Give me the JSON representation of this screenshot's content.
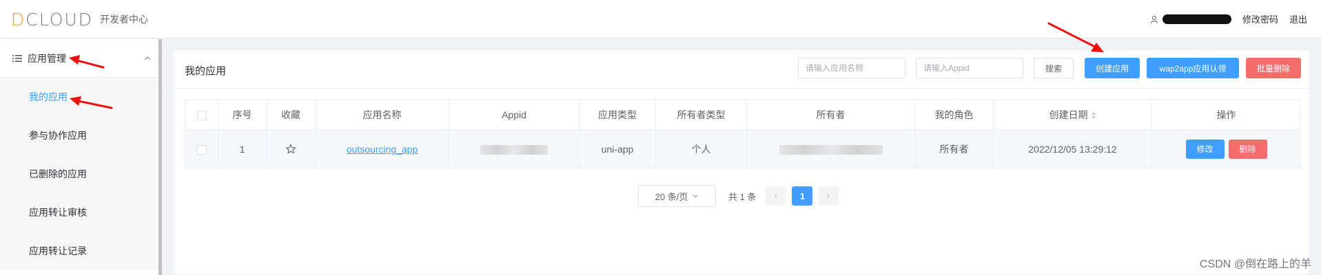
{
  "header": {
    "logo_text_d": "D",
    "logo_text_rest": "CLOUD",
    "logo_subtitle": "开发者中心",
    "change_password": "修改密码",
    "logout": "退出"
  },
  "sidebar": {
    "group_label": "应用管理",
    "items": [
      {
        "label": "我的应用",
        "active": true
      },
      {
        "label": "参与协作应用",
        "active": false
      },
      {
        "label": "已删除的应用",
        "active": false
      },
      {
        "label": "应用转让审核",
        "active": false
      },
      {
        "label": "应用转让记录",
        "active": false
      }
    ]
  },
  "main": {
    "title": "我的应用",
    "search_name_placeholder": "请输入应用名称",
    "search_appid_placeholder": "请输入Appid",
    "search_button": "搜索",
    "create_button": "创建应用",
    "wap2app_button": "wap2app应用认领",
    "batch_delete_button": "批量删除"
  },
  "table": {
    "columns": [
      "序号",
      "收藏",
      "应用名称",
      "Appid",
      "应用类型",
      "所有者类型",
      "所有者",
      "我的角色",
      "创建日期",
      "操作"
    ],
    "rows": [
      {
        "index": "1",
        "app_name": "outsourcing_app",
        "app_type": "uni-app",
        "owner_type": "个人",
        "role": "所有者",
        "created": "2022/12/05 13:29:12",
        "edit_label": "修改",
        "delete_label": "删除"
      }
    ]
  },
  "pagination": {
    "page_size": "20 条/页",
    "total": "共 1 条",
    "current_page": "1"
  },
  "watermark": "CSDN @倒在路上的羊",
  "colors": {
    "primary": "#409eff",
    "danger": "#f56c6c",
    "logo_accent": "#f29a3f",
    "annotation": "#ee1111"
  }
}
